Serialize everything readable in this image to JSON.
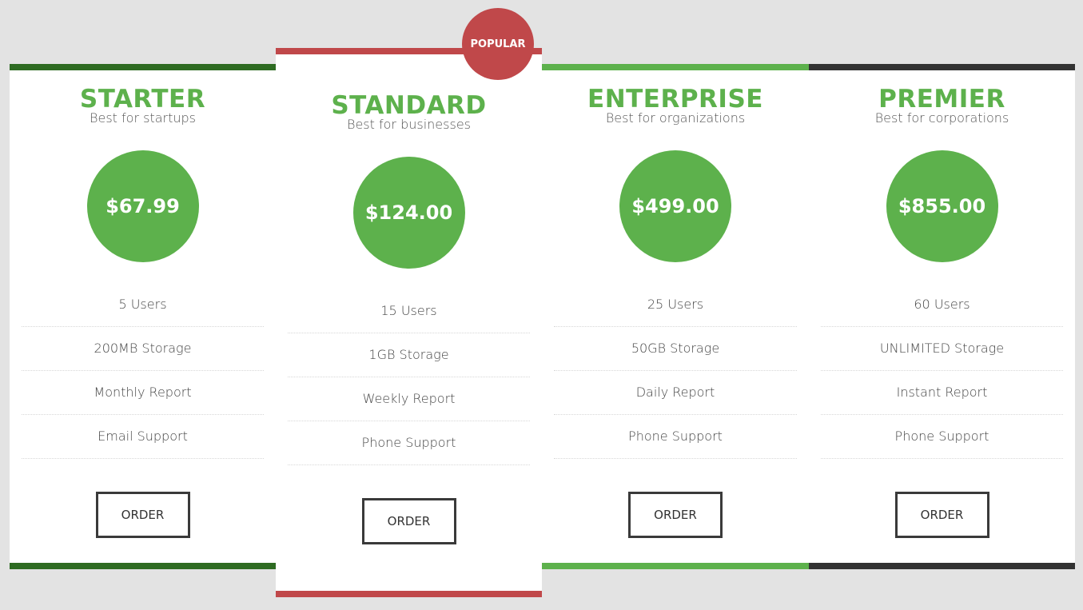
{
  "colors": {
    "background": "#e3e3e3",
    "accent_green": "#5db14c",
    "dark_green": "#2e6b22",
    "popular_red": "#c0484a",
    "dark": "#333333"
  },
  "popular_badge": "POPULAR",
  "plans": [
    {
      "name": "STARTER",
      "subtitle": "Best for startups",
      "price": "$67.99",
      "features": [
        "5 Users",
        "200MB Storage",
        "Monthly Report",
        "Email Support"
      ],
      "button": "ORDER",
      "bar_color": "#2e6b22"
    },
    {
      "name": "STANDARD",
      "subtitle": "Best for businesses",
      "price": "$124.00",
      "features": [
        "15 Users",
        "1GB Storage",
        "Weekly Report",
        "Phone Support"
      ],
      "button": "ORDER",
      "bar_color": "#c0484a"
    },
    {
      "name": "ENTERPRISE",
      "subtitle": "Best for organizations",
      "price": "$499.00",
      "features": [
        "25 Users",
        "50GB Storage",
        "Daily Report",
        "Phone Support"
      ],
      "button": "ORDER",
      "bar_color": "#5db14c"
    },
    {
      "name": "PREMIER",
      "subtitle": "Best for corporations",
      "price": "$855.00",
      "features": [
        "60 Users",
        "UNLIMITED Storage",
        "Instant Report",
        "Phone Support"
      ],
      "button": "ORDER",
      "bar_color": "#333333"
    }
  ]
}
